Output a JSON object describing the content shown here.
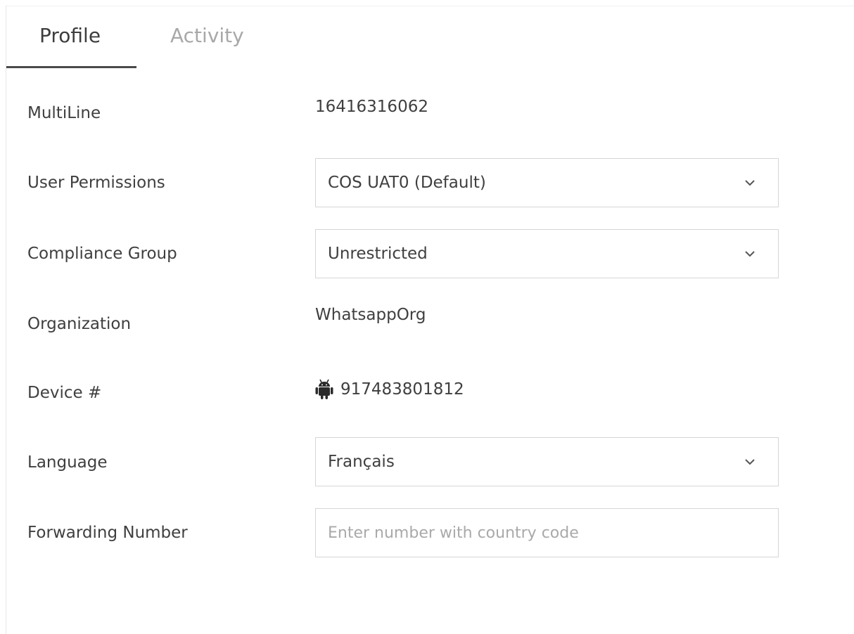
{
  "tabs": [
    {
      "label": "Profile",
      "active": true
    },
    {
      "label": "Activity",
      "active": false
    }
  ],
  "fields": {
    "multiline": {
      "label": "MultiLine",
      "value": "16416316062"
    },
    "user_permissions": {
      "label": "User Permissions",
      "selected": "COS UAT0 (Default)"
    },
    "compliance_group": {
      "label": "Compliance Group",
      "selected": "Unrestricted"
    },
    "organization": {
      "label": "Organization",
      "value": "WhatsappOrg"
    },
    "device": {
      "label": "Device #",
      "value": "917483801812",
      "icon": "android-icon"
    },
    "language": {
      "label": "Language",
      "selected": "Français"
    },
    "forwarding_number": {
      "label": "Forwarding Number",
      "value": "",
      "placeholder": "Enter number with country code"
    }
  },
  "colors": {
    "active_tab": "#3d3d3d",
    "inactive_tab": "#a8a8a8",
    "border": "#d6d6d6"
  }
}
